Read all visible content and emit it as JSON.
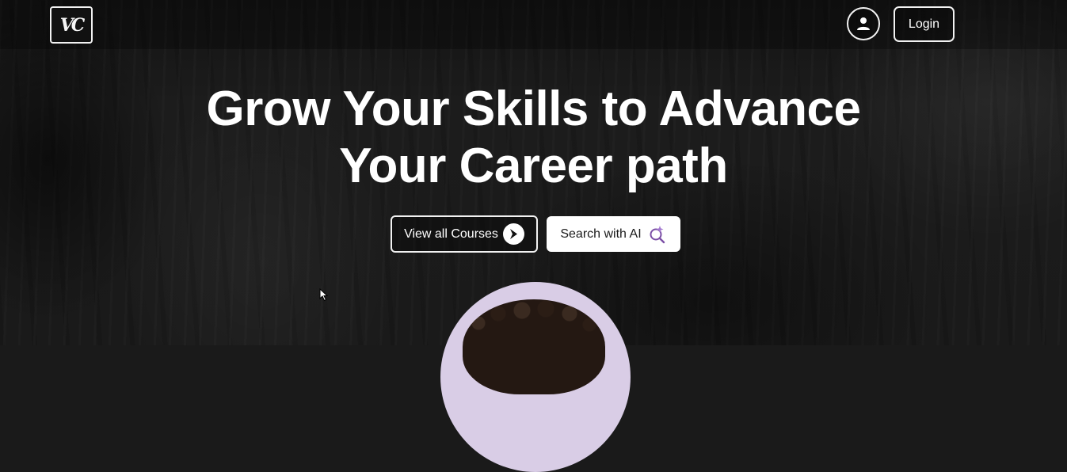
{
  "header": {
    "logo_text": "VC",
    "login_label": "Login"
  },
  "hero": {
    "title_line1": "Grow Your Skills to Advance",
    "title_line2": "Your Career path",
    "btn_courses_label": "View all Courses",
    "btn_ai_label": "Search with AI"
  },
  "icons": {
    "profile": "user-icon",
    "courses": "circle-arrow-right-icon",
    "ai_search": "sparkle-search-icon"
  },
  "colors": {
    "background": "#1a1a1a",
    "text": "#ffffff",
    "ai_accent": "#7b4fa6",
    "portrait_bg": "#d9cde6"
  }
}
